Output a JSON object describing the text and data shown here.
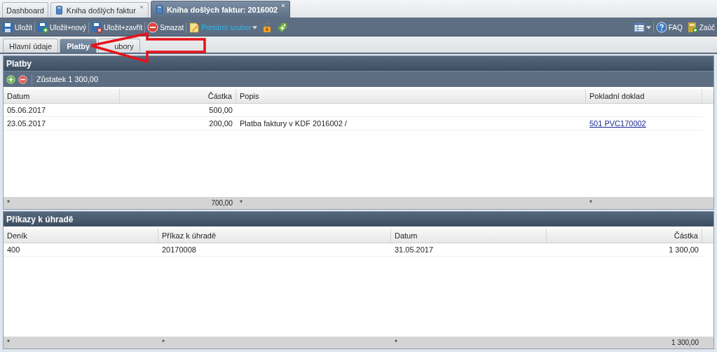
{
  "tabs": [
    {
      "label": "Dashboard",
      "kind": "plain",
      "selected": false,
      "closable": false
    },
    {
      "label": "Kniha došlých faktur",
      "kind": "document",
      "selected": false,
      "closable": true
    },
    {
      "label": "Kniha došlých faktur: 2016002",
      "kind": "document",
      "selected": true,
      "closable": true
    }
  ],
  "toolbar": {
    "left": [
      [
        {
          "kind": "save",
          "label": "Uložit"
        }
      ],
      [
        {
          "kind": "save-new",
          "label": "Uložit+nový"
        }
      ],
      [
        {
          "kind": "save-close",
          "label": "Uložit+zavřít"
        }
      ],
      [
        {
          "kind": "delete",
          "label": "Smazat"
        }
      ],
      [
        {
          "kind": "file",
          "label": "Primární soubor",
          "dropdown": true
        },
        {
          "kind": "lock"
        },
        {
          "kind": "approve"
        }
      ]
    ],
    "right": [
      [
        {
          "kind": "grid-menu",
          "dropdown": true
        }
      ],
      [
        {
          "kind": "help",
          "label": "FAQ"
        },
        {
          "kind": "book",
          "label": "Zaúč"
        }
      ]
    ]
  },
  "subtabs": [
    {
      "label": "Hlavní údaje",
      "selected": false
    },
    {
      "label": "Platby",
      "selected": true
    },
    {
      "label": "ubory",
      "selected": false
    }
  ],
  "panels": [
    {
      "title": "Platby",
      "toolbar": {
        "buttons": [
          {
            "kind": "add"
          },
          {
            "kind": "remove"
          }
        ],
        "text": "Zůstatek 1 300,00"
      },
      "columns": [
        {
          "label": "Datum",
          "right_aligned": false,
          "kind": "text"
        },
        {
          "label": "Částka",
          "right_aligned": true,
          "kind": "text"
        },
        {
          "label": "Popis",
          "right_aligned": false,
          "kind": "text"
        },
        {
          "label": "Pokladní doklad",
          "right_aligned": false,
          "kind": "link"
        }
      ],
      "rows": [
        [
          "05.06.2017",
          "500,00",
          null,
          null
        ],
        [
          "23.05.2017",
          "200,00",
          "Platba faktury v KDF 2016002 /",
          "501 PVC170002"
        ]
      ],
      "summary": [
        "*",
        "700,00",
        "*",
        "*"
      ]
    },
    {
      "title": "Příkazy k úhradě",
      "columns": [
        {
          "label": "Deník",
          "right_aligned": false,
          "kind": "text"
        },
        {
          "label": "Příkaz k úhradě",
          "right_aligned": false,
          "kind": "text"
        },
        {
          "label": "Datum",
          "right_aligned": false,
          "kind": "text"
        },
        {
          "label": "Částka",
          "right_aligned": true,
          "kind": "text"
        }
      ],
      "rows": [
        [
          "400",
          "20170008",
          "31.05.2017",
          "1 300,00"
        ]
      ],
      "summary": [
        "*",
        "*",
        "*",
        "1 300,00"
      ]
    }
  ]
}
